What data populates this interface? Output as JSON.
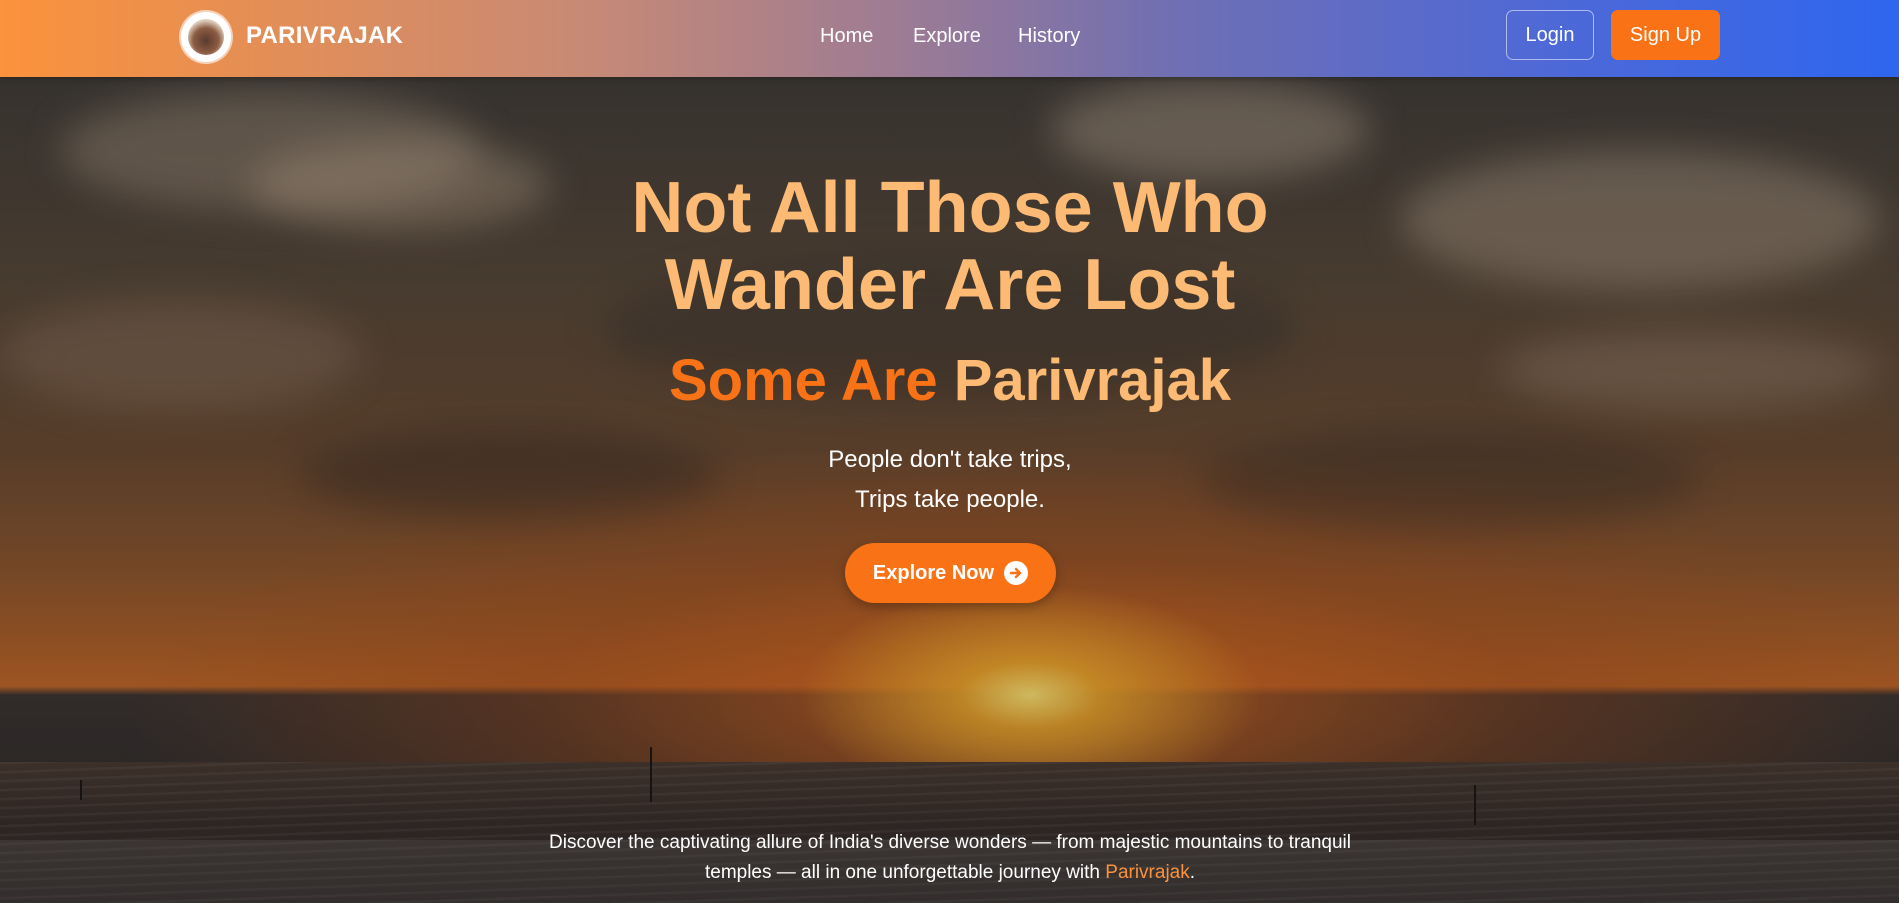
{
  "navbar": {
    "brand": "PARIVRAJAK",
    "links": [
      "Home",
      "Explore",
      "History"
    ],
    "login_label": "Login",
    "signup_label": "Sign Up"
  },
  "hero": {
    "headline_line1": "Not All Those Who",
    "headline_line2": "Wander Are Lost",
    "subhead_part1": "Some Are",
    "subhead_part2": "Parivrajak",
    "tagline_line1": "People don't take trips,",
    "tagline_line2": "Trips take people.",
    "cta_label": "Explore Now",
    "cta_icon": "arrow-circle-right-icon"
  },
  "footer": {
    "text_before": "Discover the captivating allure of India's diverse wonders — from majestic mountains to tranquil temples — all in one unforgettable journey with",
    "highlight": "Parivrajak",
    "text_after": "."
  },
  "colors": {
    "accent_orange": "#f97316",
    "soft_orange": "#fdba74",
    "nav_gradient_start": "#fb923c",
    "nav_gradient_end": "#2e66ef"
  }
}
